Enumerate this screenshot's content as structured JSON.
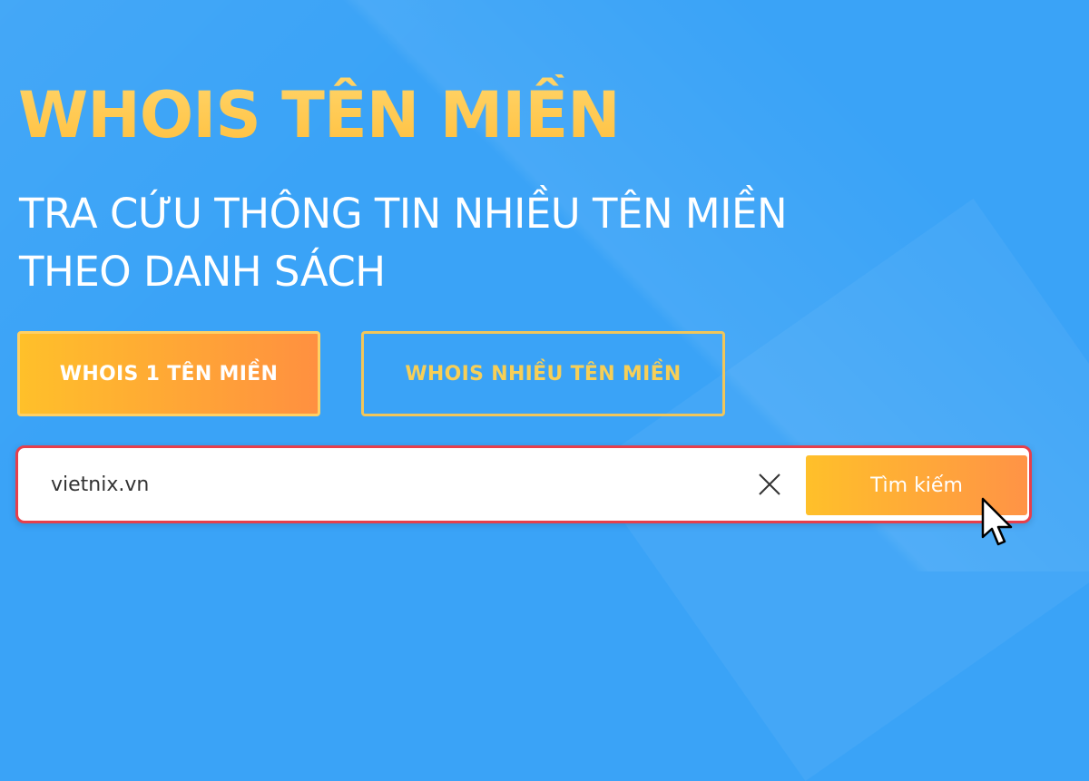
{
  "hero": {
    "title": "WHOIS TÊN MIỀN",
    "subtitle_line1": "TRA CỨU THÔNG TIN NHIỀU TÊN MIỀN",
    "subtitle_line2": "THEO DANH SÁCH"
  },
  "tabs": [
    {
      "label": "WHOIS 1 TÊN MIỀN",
      "active": true
    },
    {
      "label": "WHOIS NHIỀU TÊN MIỀN",
      "active": false
    }
  ],
  "search": {
    "value": "vietnix.vn",
    "clear_icon": "close-icon",
    "button_label": "Tìm kiếm"
  },
  "pointer": {
    "icon": "mouse-pointer-icon"
  },
  "colors": {
    "background": "#3aa3f7",
    "title": "#ffc84d",
    "accent_start": "#ffc02a",
    "accent_end": "#ff9040",
    "search_border": "#e63f4b"
  }
}
